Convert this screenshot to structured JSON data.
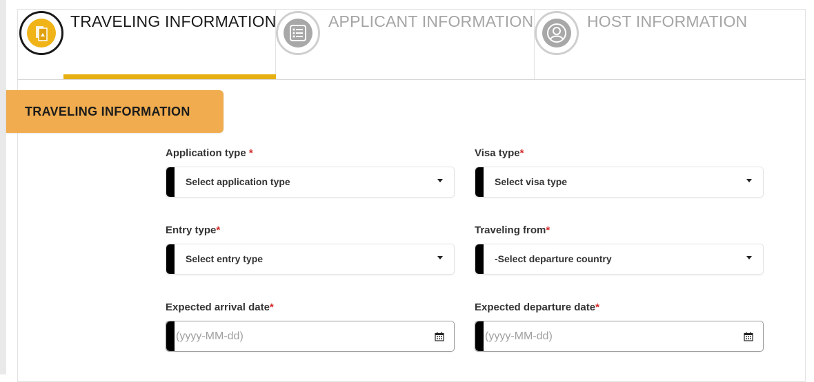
{
  "tabs": [
    {
      "label": "TRAVELING INFORMATION",
      "icon": "passport-icon",
      "state": "active"
    },
    {
      "label": "APPLICANT INFORMATION",
      "icon": "list-icon",
      "state": "inactive"
    },
    {
      "label": "HOST INFORMATION",
      "icon": "user-icon",
      "state": "inactive"
    }
  ],
  "section": {
    "title": "TRAVELING INFORMATION"
  },
  "form": {
    "application_type": {
      "label": "Application type ",
      "required_mark": "*",
      "value": "Select application type"
    },
    "visa_type": {
      "label": "Visa type",
      "required_mark": "*",
      "value": "Select visa type"
    },
    "entry_type": {
      "label": "Entry type",
      "required_mark": "*",
      "value": "Select entry type"
    },
    "traveling_from": {
      "label": "Traveling from",
      "required_mark": "*",
      "value": "-Select departure country"
    },
    "arrival_date": {
      "label": "Expected arrival date",
      "required_mark": "*",
      "placeholder": "(yyyy-MM-dd)",
      "value": ""
    },
    "departure_date": {
      "label": "Expected departure date",
      "required_mark": "*",
      "placeholder": "(yyyy-MM-dd)",
      "value": ""
    }
  },
  "colors": {
    "accent": "#e6b013",
    "section_header": "#f0ac4e",
    "required": "#d42a2a",
    "inactive_text": "#a5a5a5"
  }
}
